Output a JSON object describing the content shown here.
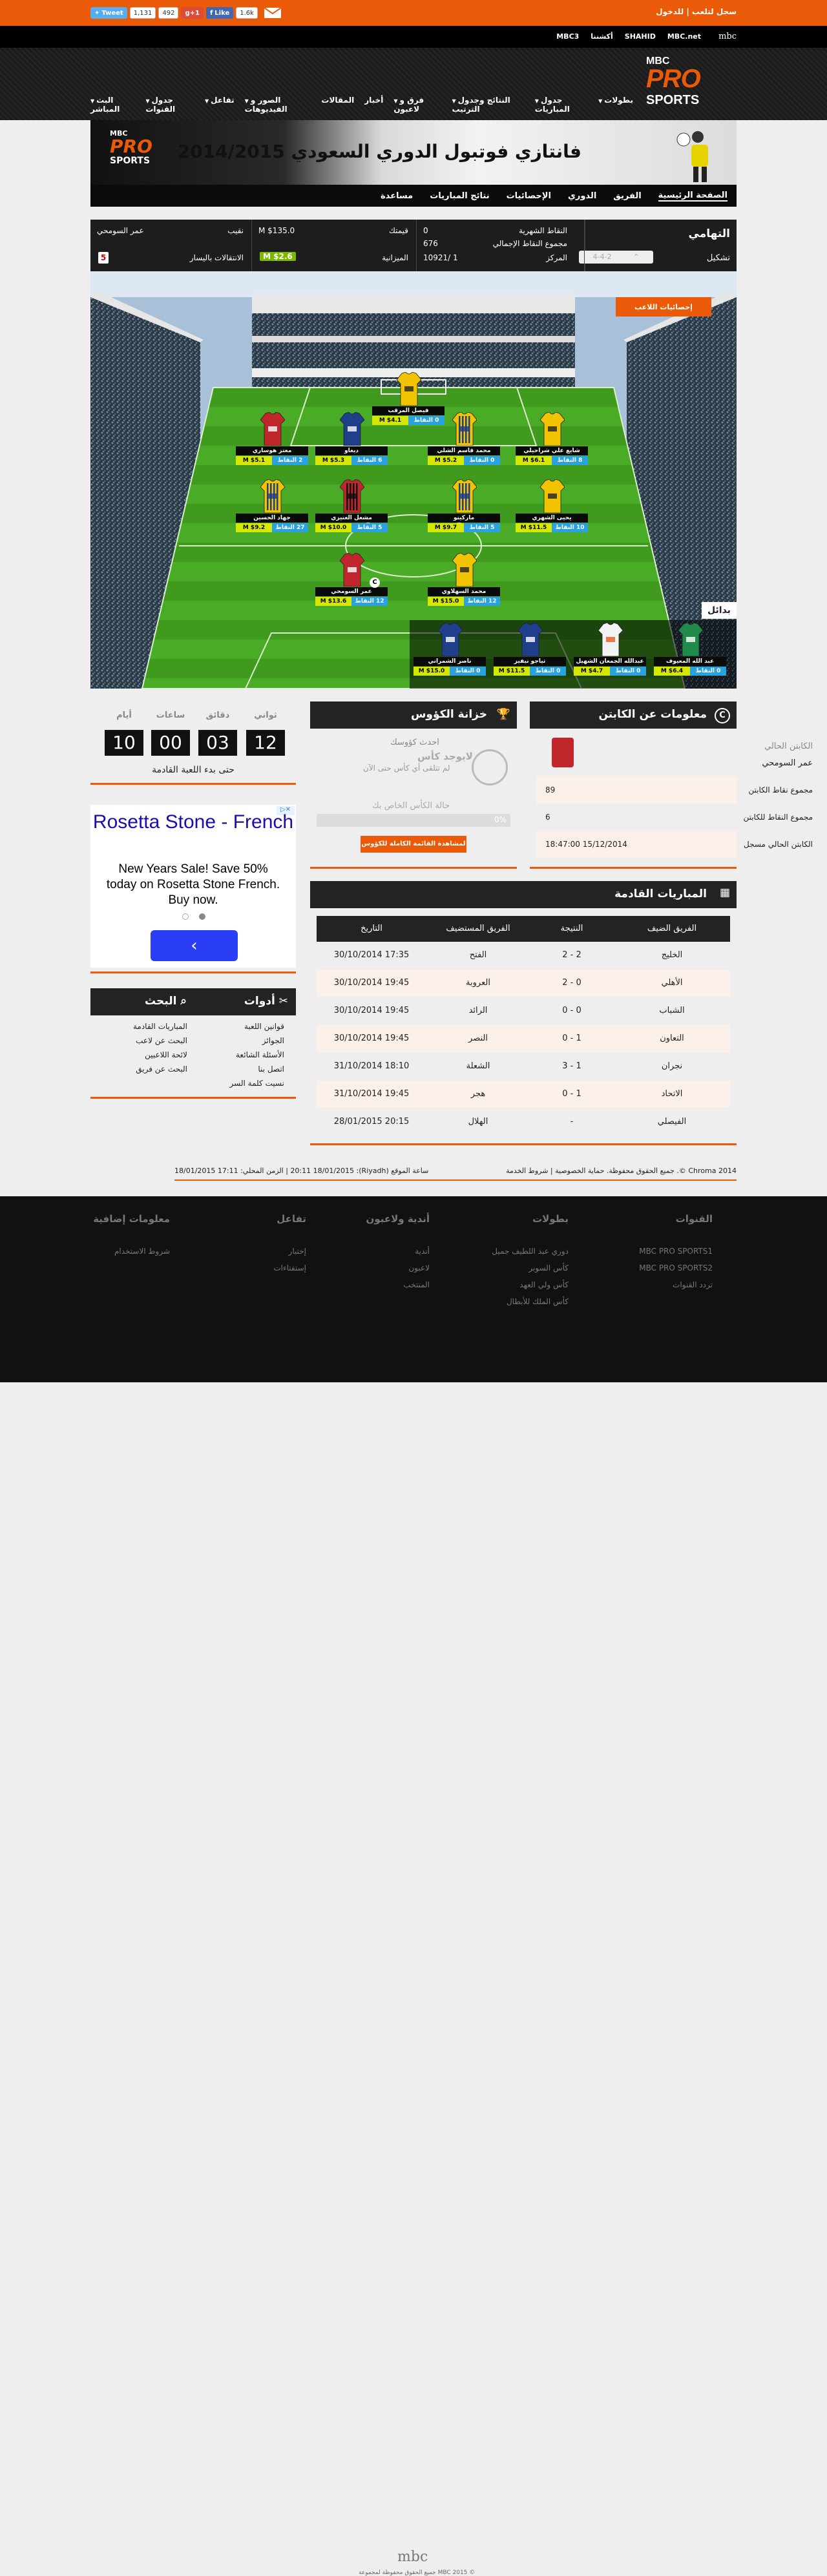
{
  "topbar": {
    "login": "سجل لتلعب | للدخول",
    "tweet": "Tweet",
    "tweet_count": "1,131",
    "gplus_count": "492",
    "gplus": "g+1",
    "like": "Like",
    "like_count": "1.6k"
  },
  "mbcbar": {
    "links": [
      "MBC3",
      "أكشننا",
      "SHAHID",
      "MBC.net"
    ],
    "logo": "mbc"
  },
  "header": {
    "logo_top": "MBC",
    "logo_mid": "PRO",
    "logo_bot": "SPORTS",
    "nav": [
      "بطولات",
      "جدول المباريات",
      "النتائج وجدول الترتيب",
      "فرق و لاعبون",
      "أخبار",
      "المقالات",
      "الصور و الفيديوهات",
      "تفاعل",
      "جدول القنوات",
      "البث المباشر"
    ]
  },
  "banner": {
    "title": "فانتازي فوتبول الدوري السعودي 2014/2015"
  },
  "submenu": [
    "الصفحة الرئيسية",
    "الفريق",
    "الدوري",
    "الإحصائيات",
    "نتائج المباريات",
    "مساعدة"
  ],
  "team": {
    "name": "التهامي",
    "formation_label": "تشكيل",
    "formation": "4-4-2",
    "monthly_label": "النقاط الشهرية",
    "monthly": "0",
    "total_label": "مجموع النقاط الإجمالي",
    "total": "676",
    "rank_label": "المركز",
    "rank": "10921/ 1",
    "value_label": "قيمتك",
    "value": "M $135.0",
    "budget_label": "الميزانية",
    "budget": "M $2.6",
    "captain_label": "نقيب",
    "captain": "عمر السومحي",
    "transfers_label": "الانتقالات باليسار",
    "transfers": "5"
  },
  "pitch": {
    "stats_btn": "إحصائيات اللاعب",
    "subs_label": "بدائل",
    "players": [
      {
        "name": "فيصل المرقب",
        "pts": "0 النقاط",
        "price": "M $4.1",
        "kit": "yellow"
      },
      {
        "name": "معتز هوساري",
        "pts": "2 النقاط",
        "price": "M $5.1",
        "kit": "red"
      },
      {
        "name": "ديغاو",
        "pts": "6 النقاط",
        "price": "M $5.3",
        "kit": "blue"
      },
      {
        "name": "محمد قاسم الشلي",
        "pts": "0 النقاط",
        "price": "M $5.2",
        "kit": "stripe"
      },
      {
        "name": "شايع علي شراحيلي",
        "pts": "8 النقاط",
        "price": "M $6.1",
        "kit": "yellow"
      },
      {
        "name": "جهاد الحسين",
        "pts": "27 النقاط",
        "price": "M $9.2",
        "kit": "stripe"
      },
      {
        "name": "مشعل العنيزي",
        "pts": "5 النقاط",
        "price": "M $10.0",
        "kit": "redblack"
      },
      {
        "name": "ماركينو",
        "pts": "5 النقاط",
        "price": "M $9.7",
        "kit": "stripe"
      },
      {
        "name": "يحيى الشهري",
        "pts": "10 النقاط",
        "price": "M $11.5",
        "kit": "yellow"
      },
      {
        "name": "عمر السومحي",
        "pts": "12 النقاط",
        "price": "M $13.6",
        "kit": "red"
      },
      {
        "name": "محمد السهلاوي",
        "pts": "12 النقاط",
        "price": "M $15.0",
        "kit": "yellow"
      },
      {
        "name": "ناصر الشمراني",
        "pts": "0 النقاط",
        "price": "M $15.0",
        "kit": "blue"
      },
      {
        "name": "تياجو نيفيز",
        "pts": "0 النقاط",
        "price": "M $11.5",
        "kit": "blue"
      },
      {
        "name": "عبدالله الجمعان الشهيل",
        "pts": "0 النقاط",
        "price": "M $4.7",
        "kit": "white"
      },
      {
        "name": "عبد الله المعيوف",
        "pts": "0 النقاط",
        "price": "M $6.4",
        "kit": "green"
      }
    ]
  },
  "countdown": {
    "labels": [
      "أيام",
      "ساعات",
      "دقائق",
      "ثواني"
    ],
    "values": [
      "10",
      "00",
      "03",
      "12"
    ],
    "caption": "حتى بدء اللعبة القادمة"
  },
  "ad": {
    "title": "Rosetta Stone - French",
    "body": "New Years Sale! Save 50% today on Rosetta Stone French. Buy now."
  },
  "trophy": {
    "title": "خزانة الكؤوس",
    "latest": "احدث كؤوسك",
    "none": "لايوجد كأس",
    "none_sub": "لم تتلقى أي كأس حتى الآن",
    "status": "حالة الكأس الخاص بك",
    "pct": "0%",
    "btn": "لمشاهدة القائمة الكاملة للكؤوس"
  },
  "captain": {
    "title": "معلومات عن الكابتن",
    "current_label": "الكابتن الحالي",
    "current": "عمر السومحي",
    "rows": [
      {
        "label": "مجموع نقاط الكابتن",
        "value": "89"
      },
      {
        "label": "مجموع النقاط للكابتن",
        "value": "6"
      },
      {
        "label": "الكابتن الحالي مسجل",
        "value": "18:47:00 15/12/2014"
      }
    ]
  },
  "matches": {
    "title": "المباريات القادمة",
    "headers": [
      "الفريق الضيف",
      "النتيجة",
      "الفريق المستضيف",
      "التاريخ"
    ],
    "rows": [
      [
        "الخليج",
        "2 - 2",
        "الفتح",
        "30/10/2014 17:35"
      ],
      [
        "الأهلي",
        "2 - 0",
        "العروبة",
        "30/10/2014 19:45"
      ],
      [
        "الشباب",
        "0 - 0",
        "الرائد",
        "30/10/2014 19:45"
      ],
      [
        "التعاون",
        "0 - 1",
        "النصر",
        "30/10/2014 19:45"
      ],
      [
        "نجران",
        "3 - 1",
        "الشعلة",
        "31/10/2014 18:10"
      ],
      [
        "الاتحاد",
        "0 - 1",
        "هجر",
        "31/10/2014 19:45"
      ],
      [
        "الفيصلي",
        "-",
        "الهلال",
        "28/01/2015 20:15"
      ]
    ]
  },
  "tools": {
    "title": "أدوات",
    "search_title": "البحث",
    "col1": [
      "قوانين اللعبة",
      "الجوائز",
      "الأسئلة الشائعة",
      "اتصل بنا",
      "نسيت كلمة السر"
    ],
    "col2": [
      "المباريات القادمة",
      "البحث عن لاعب",
      "لائحة اللاعبين",
      "البحث عن فريق"
    ]
  },
  "legal": {
    "left": "Chroma 2014 ©. جميع الحقوق محفوظة. حماية الخصوصية | شروط الخدمة",
    "right": "ساعة الموقع (Riyadh): 20:11 18/01/2015 | الزمن المحلي: 17:11 18/01/2015"
  },
  "footer": {
    "cols": [
      {
        "h": "القنوات",
        "items": [
          "MBC PRO SPORTS1",
          "MBC PRO SPORTS2",
          "تردد القنوات"
        ]
      },
      {
        "h": "بطولات",
        "items": [
          "دوري عبد اللطيف جميل",
          "كأس السوبر",
          "كأس ولي العهد",
          "كأس الملك للأبطال"
        ]
      },
      {
        "h": "أندية ولاعبون",
        "items": [
          "أندية",
          "لاعبون",
          "المنتخب"
        ]
      },
      {
        "h": "تفاعل",
        "items": [
          "إختبار",
          "إستفتاءات"
        ]
      },
      {
        "h": "معلومات إضافية",
        "items": [
          "شروط الاستخدام"
        ]
      }
    ],
    "copyright": "جميع الحقوق محفوظة لمجموعة MBC 2015 ©",
    "logo": "mbc"
  },
  "colors": {
    "accent": "#ea5a09",
    "dark": "#232323",
    "pitch": "#3f9a1e",
    "points": "#29a3e0",
    "price": "#d6e800"
  }
}
